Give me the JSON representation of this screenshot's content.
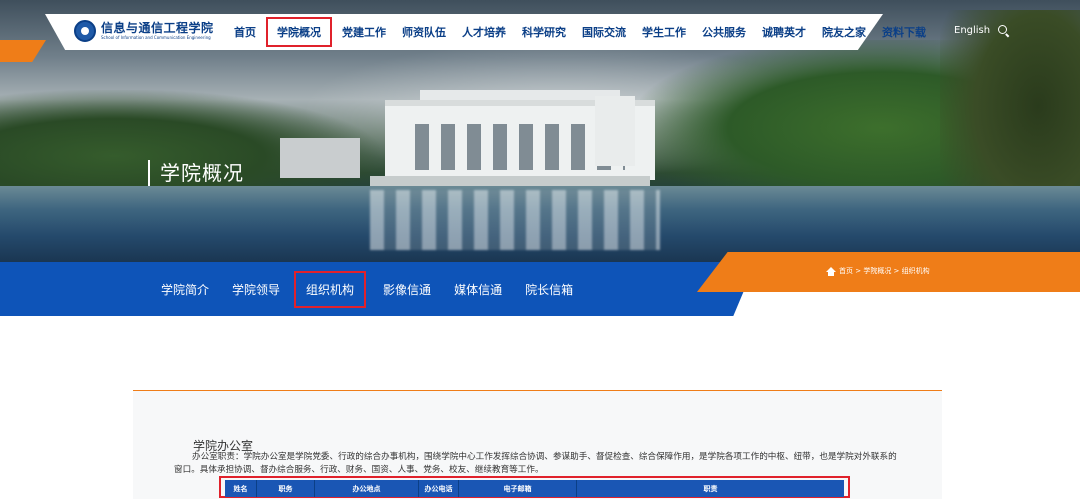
{
  "header": {
    "logo_cn": "信息与通信工程学院",
    "logo_en": "School of Information and Communication Engineering",
    "menu": [
      "首页",
      "学院概况",
      "党建工作",
      "师资队伍",
      "人才培养",
      "科学研究",
      "国际交流",
      "学生工作",
      "公共服务",
      "诚聘英才",
      "院友之家",
      "资料下载"
    ],
    "active_menu": "学院概况",
    "language_link": "English",
    "search_icon": "search-icon"
  },
  "hero": {
    "title": "学院概况"
  },
  "subnav": {
    "items": [
      "学院简介",
      "学院领导",
      "组织机构",
      "影像信通",
      "媒体信通",
      "院长信箱"
    ],
    "active": "组织机构"
  },
  "breadcrumb": {
    "icon": "home-icon",
    "text": "首页 > 学院概况 > 组织机构"
  },
  "content": {
    "section_title": "学院办公室",
    "section_desc": "办公室职责：学院办公室是学院党委、行政的综合办事机构，围绕学院中心工作发挥综合协调、参谋助手、督促检查、综合保障作用，是学院各项工作的中枢、纽带，也是学院对外联系的窗口。具体承担协调、督办综合服务、行政、财务、国资、人事、党务、校友、继续教育等工作。",
    "table_headers": [
      "姓名",
      "职务",
      "办公地点",
      "办公电话",
      "电子邮箱",
      "职责"
    ]
  },
  "colors": {
    "primary_blue": "#0e54b8",
    "accent_orange": "#ef7d18",
    "highlight_red": "#e0212b"
  }
}
